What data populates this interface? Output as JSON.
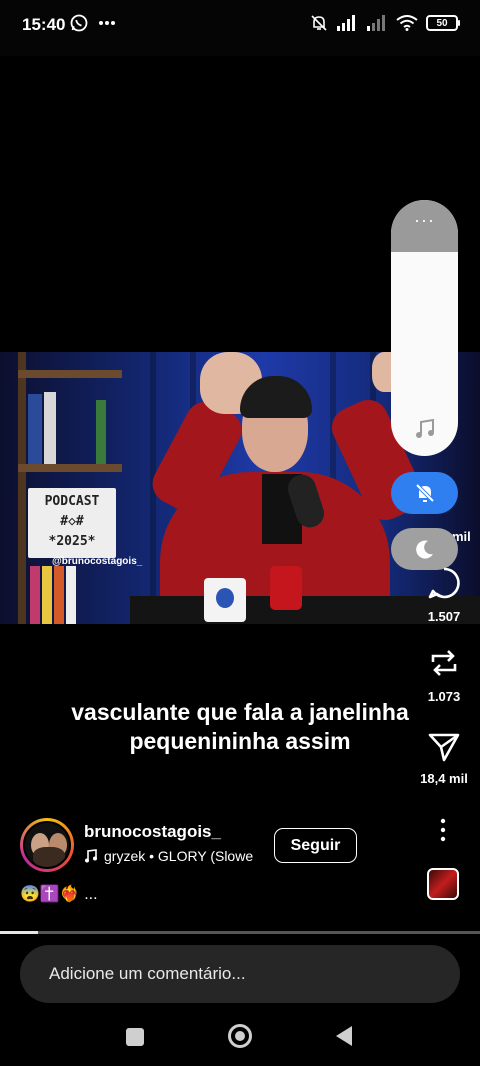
{
  "status_bar": {
    "time": "15:40",
    "battery": "50"
  },
  "video": {
    "handle_overlay": "@brunocostagois_",
    "sign_lines": [
      "PODCAST",
      "#◇#",
      "*2025*"
    ]
  },
  "quick_panel": {
    "dots": "···",
    "music_icon": "music-note-icon",
    "mute_icon": "bell-off-icon",
    "dnd_icon": "moon-icon"
  },
  "actions": {
    "likes_partial": "mil",
    "comments": "1.507",
    "reposts": "1.073",
    "shares": "18,4 mil"
  },
  "caption": {
    "line1": "vasculante que fala a janelinha",
    "line2": "pequenininha assim"
  },
  "author": {
    "username": "brunocostagois_",
    "music": "gryzek • GLORY (Slowe",
    "follow_label": "Seguir",
    "emojis": "😨✝️❤️‍🔥 ..."
  },
  "progress": {
    "fraction": 0.08
  },
  "comment": {
    "placeholder": "Adicione um comentário..."
  }
}
